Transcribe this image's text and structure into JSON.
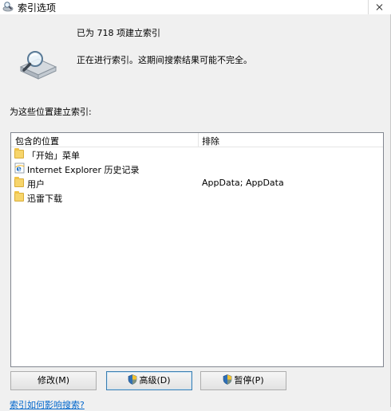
{
  "window": {
    "title": "索引选项",
    "close_icon": "close-icon"
  },
  "summary": {
    "item_count_text": "已为 718 项建立索引",
    "status_text": "正在进行索引。这期间搜索结果可能不完全。"
  },
  "locations_label": "为这些位置建立索引:",
  "list": {
    "columns": {
      "location": "包含的位置",
      "exclude": "排除"
    },
    "rows": [
      {
        "location": "「开始」菜单",
        "exclude": "",
        "icon": "folder-icon"
      },
      {
        "location": "Internet Explorer 历史记录",
        "exclude": "",
        "icon": "ie-icon"
      },
      {
        "location": "用户",
        "exclude": "AppData; AppData",
        "icon": "folder-icon"
      },
      {
        "location": "迅雷下载",
        "exclude": "",
        "icon": "folder-icon"
      }
    ]
  },
  "buttons": {
    "modify": "修改(M)",
    "advanced": "高级(D)",
    "pause": "暂停(P)"
  },
  "help_link": "索引如何影响搜索?",
  "colors": {
    "background": "#f0f0f0",
    "link": "#0066cc",
    "list_border": "#828790"
  }
}
